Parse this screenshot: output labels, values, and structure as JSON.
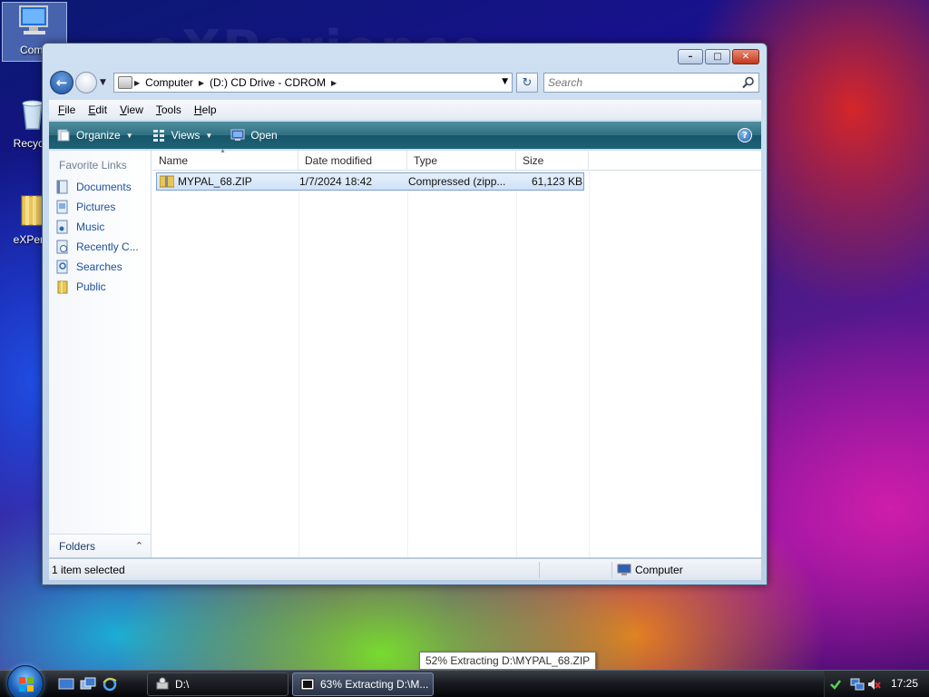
{
  "wallpaper": {
    "watermark": "eXPerience"
  },
  "desktop": {
    "icons": [
      {
        "label": "Comp",
        "icon": "computer-icon"
      },
      {
        "label": "Recycle",
        "icon": "recycle-bin-icon"
      },
      {
        "label": "eXPerie",
        "icon": "folder-icon"
      }
    ]
  },
  "window": {
    "address": {
      "crumbs": [
        "Computer",
        "(D:) CD Drive - CDROM"
      ]
    },
    "search": {
      "placeholder": "Search"
    },
    "menu": [
      "File",
      "Edit",
      "View",
      "Tools",
      "Help"
    ],
    "commands": {
      "organize": "Organize",
      "views": "Views",
      "open": "Open"
    },
    "nav_pane": {
      "title": "Favorite Links",
      "links": [
        "Documents",
        "Pictures",
        "Music",
        "Recently C...",
        "Searches",
        "Public"
      ],
      "folders_label": "Folders"
    },
    "columns": [
      "Name",
      "Date modified",
      "Type",
      "Size"
    ],
    "files": [
      {
        "name": "MYPAL_68.ZIP",
        "date": "1/7/2024 18:42",
        "type": "Compressed (zipp...",
        "size": "61,123 KB"
      }
    ],
    "status": {
      "left": "1 item selected",
      "right": "Computer"
    }
  },
  "tooltip": "52% Extracting D:\\MYPAL_68.ZIP",
  "taskbar": {
    "buttons": [
      {
        "label": "D:\\",
        "active": false
      },
      {
        "label": "63% Extracting D:\\M...",
        "active": true
      }
    ],
    "clock": "17:25"
  },
  "colors": {
    "accent": "#2f6f82",
    "link": "#1f4f9a",
    "selection": "#cfe2f8"
  }
}
